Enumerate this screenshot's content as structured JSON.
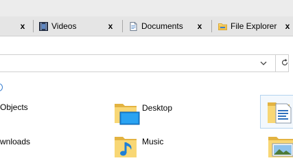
{
  "tabs": [
    {
      "label": "Videos",
      "icon": "video-icon",
      "close": "x"
    },
    {
      "label": "Documents",
      "icon": "document-icon",
      "close": "x"
    },
    {
      "label": "File Explorer",
      "icon": "folder-icon",
      "close": "x"
    }
  ],
  "partial_tab_close": "x",
  "address": {
    "value": ""
  },
  "items": {
    "objects_label": "Objects",
    "desktop_label": "Desktop",
    "downloads_label": "wnloads",
    "music_label": "Music"
  },
  "colors": {
    "folder": "#f8d775",
    "folder_dark": "#e3b341",
    "accent": "#0078d7",
    "tab_bg": "#e5e5e5"
  }
}
